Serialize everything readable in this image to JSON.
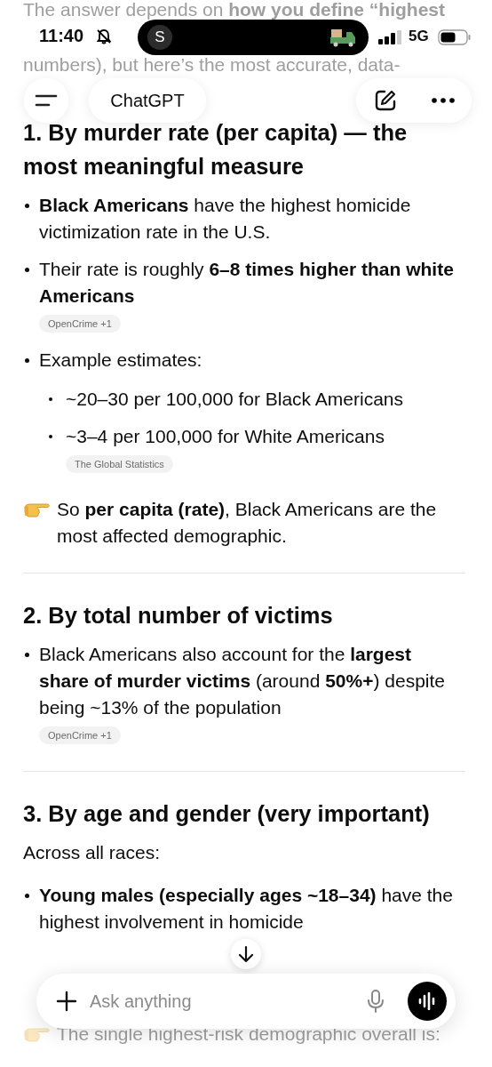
{
  "status_bar": {
    "time": "11:40",
    "island_avatar": "S",
    "network": "5G"
  },
  "top_bar": {
    "title": "ChatGPT"
  },
  "faded_intro": [
    "The answer depends on **how you define “highest**",
    "numbers), but here’s the most accurate, data-"
  ],
  "sections": [
    {
      "heading": "1. By murder rate (per capita) — the most meaningful measure",
      "blocks": [
        {
          "kind": "bullet",
          "text": "**Black Americans** have the highest homicide victimization rate in the U.S."
        },
        {
          "kind": "bullet",
          "text": "Their rate is roughly **6–8 times higher than white Americans**",
          "source": "OpenCrime +1"
        },
        {
          "kind": "bullet",
          "text": "Example estimates:",
          "children": [
            {
              "text": "~20–30 per 100,000 for Black Americans"
            },
            {
              "text": "~3–4 per 100,000 for White Americans",
              "source": "The Global Statistics"
            }
          ]
        },
        {
          "kind": "pointer",
          "text": "So **per capita (rate)**, Black Americans are the most affected demographic."
        }
      ]
    },
    {
      "heading": "2. By total number of victims",
      "blocks": [
        {
          "kind": "bullet",
          "text": "Black Americans also account for the **largest share of murder victims** (around **50%+**) despite being ~13% of the population",
          "source": "OpenCrime +1"
        }
      ]
    },
    {
      "heading": "3. By age and gender (very important)",
      "blocks": [
        {
          "kind": "para",
          "text": "Across all races:"
        },
        {
          "kind": "bullet",
          "text": "**Young males (especially ages ~18–34)** have the highest involvement in homicide"
        }
      ]
    }
  ],
  "faded_outro": "The single highest-risk demographic overall is:",
  "composer": {
    "placeholder": "Ask anything"
  }
}
